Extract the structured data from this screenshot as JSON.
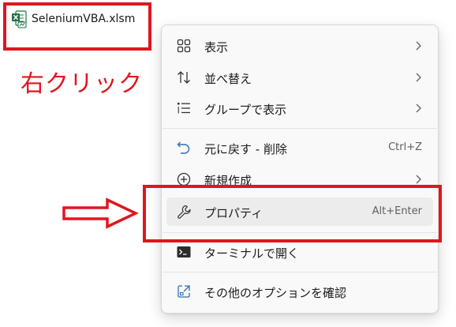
{
  "file": {
    "name": "SeleniumVBA.xlsm",
    "icon": "excel-file-icon"
  },
  "annotation": {
    "right_click_label": "右クリック",
    "color": "#e0161e",
    "arrow": "right-arrow-icon"
  },
  "menu": {
    "items": [
      {
        "label": "表示",
        "icon": "view-grid-icon",
        "submenu": true
      },
      {
        "label": "並べ替え",
        "icon": "sort-icon",
        "submenu": true
      },
      {
        "label": "グループで表示",
        "icon": "group-by-icon",
        "submenu": true
      },
      {
        "label": "元に戻す - 削除",
        "icon": "undo-icon",
        "shortcut": "Ctrl+Z"
      },
      {
        "label": "新規作成",
        "icon": "new-icon",
        "submenu": true
      },
      {
        "label": "プロパティ",
        "icon": "wrench-icon",
        "shortcut": "Alt+Enter",
        "highlighted": true
      },
      {
        "label": "ターミナルで開く",
        "icon": "terminal-icon"
      },
      {
        "label": "その他のオプションを確認",
        "icon": "more-options-icon"
      }
    ]
  }
}
